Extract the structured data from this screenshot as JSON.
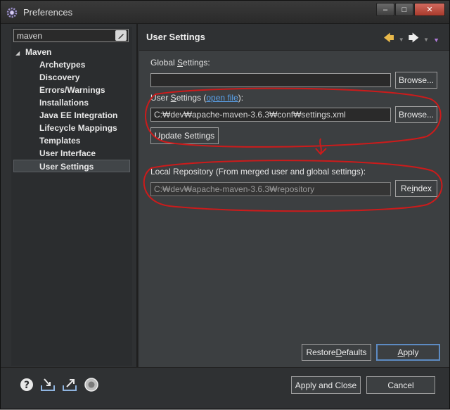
{
  "window": {
    "title": "Preferences",
    "minimize_glyph": "‒",
    "maximize_glyph": "□",
    "close_glyph": "✕"
  },
  "left": {
    "filter_value": "maven",
    "tree": {
      "root": "Maven",
      "items": [
        "Archetypes",
        "Discovery",
        "Errors/Warnings",
        "Installations",
        "Java EE Integration",
        "Lifecycle Mappings",
        "Templates",
        "User Interface",
        "User Settings"
      ],
      "selected_index": 8
    }
  },
  "page": {
    "title": "User Settings",
    "global_label_pre": "Global ",
    "global_label_mnemonic": "S",
    "global_label_post": "ettings:",
    "global_value": "",
    "browse_label": "Browse...",
    "user_label_pre": "User ",
    "user_label_mnemonic": "S",
    "user_label_post": "ettings (",
    "open_file_label": "open file",
    "user_label_end": "):",
    "user_value": "C:₩dev₩apache-maven-3.6.3₩conf₩settings.xml",
    "update_label": "Update Settings",
    "local_repo_label": "Local Repository (From merged user and global settings):",
    "local_repo_value": "C:₩dev₩apache-maven-3.6.3₩repository",
    "reindex_pre": "Re",
    "reindex_mnemonic": "i",
    "reindex_post": "ndex",
    "restore_pre": "Restore ",
    "restore_mnemonic": "D",
    "restore_post": "efaults",
    "apply_mnemonic": "A",
    "apply_post": "pply"
  },
  "footer": {
    "apply_close_label": "Apply and Close",
    "cancel_label": "Cancel"
  },
  "colors": {
    "annotation": "#cc1b1b",
    "link": "#5aa0e8",
    "default_button_border": "#5d8bc2"
  },
  "icons": [
    "app-gear-icon",
    "back-arrow-icon",
    "forward-arrow-icon",
    "view-menu-icon",
    "help-icon",
    "import-icon",
    "export-icon",
    "oomph-record-icon"
  ]
}
